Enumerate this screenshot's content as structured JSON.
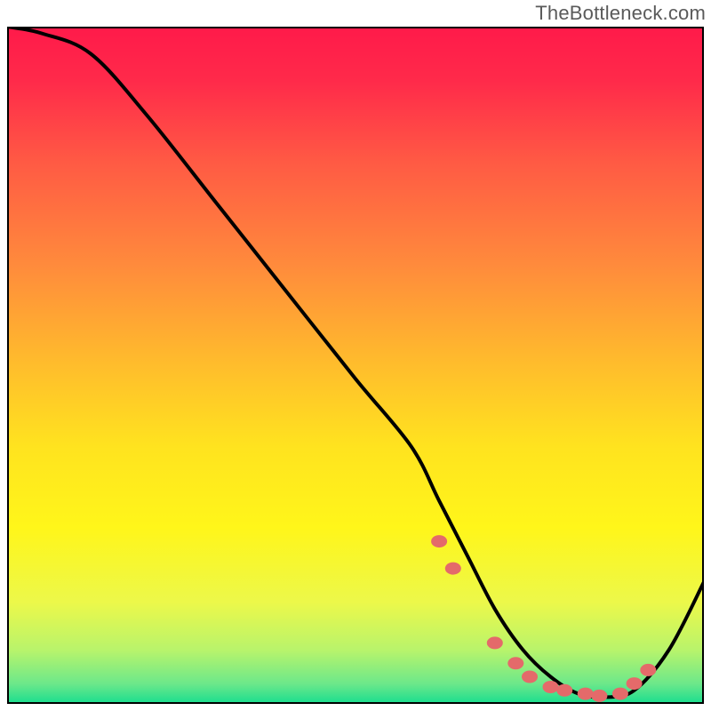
{
  "attribution": "TheBottleneck.com",
  "gradient_stops": [
    {
      "offset": 0,
      "color": "#ff1a4a"
    },
    {
      "offset": 0.08,
      "color": "#ff2a4a"
    },
    {
      "offset": 0.2,
      "color": "#ff5a44"
    },
    {
      "offset": 0.35,
      "color": "#ff8a3c"
    },
    {
      "offset": 0.5,
      "color": "#ffbd2c"
    },
    {
      "offset": 0.62,
      "color": "#ffe31f"
    },
    {
      "offset": 0.74,
      "color": "#fff61a"
    },
    {
      "offset": 0.85,
      "color": "#ecf84a"
    },
    {
      "offset": 0.92,
      "color": "#b9f46b"
    },
    {
      "offset": 0.97,
      "color": "#6de88a"
    },
    {
      "offset": 1.0,
      "color": "#18dd8f"
    }
  ],
  "chart_data": {
    "type": "line",
    "title": "",
    "xlabel": "",
    "ylabel": "",
    "xlim": [
      0,
      100
    ],
    "ylim": [
      0,
      100
    ],
    "grid": false,
    "legend": null,
    "series": [
      {
        "name": "bottleneck-curve",
        "x": [
          0,
          5,
          12,
          20,
          30,
          40,
          50,
          58,
          62,
          66,
          70,
          74,
          78,
          82,
          86,
          90,
          95,
          100
        ],
        "y": [
          100,
          99,
          96,
          87,
          74,
          61,
          48,
          38,
          30,
          22,
          14,
          8,
          4,
          1.5,
          1,
          2,
          8,
          18
        ]
      }
    ],
    "markers": {
      "name": "highlight-points",
      "color": "#e46a6a",
      "x": [
        62,
        64,
        70,
        73,
        75,
        78,
        80,
        83,
        85,
        88,
        90,
        92
      ],
      "y": [
        24,
        20,
        9,
        6,
        4,
        2.5,
        2,
        1.5,
        1.2,
        1.5,
        3,
        5
      ]
    }
  }
}
